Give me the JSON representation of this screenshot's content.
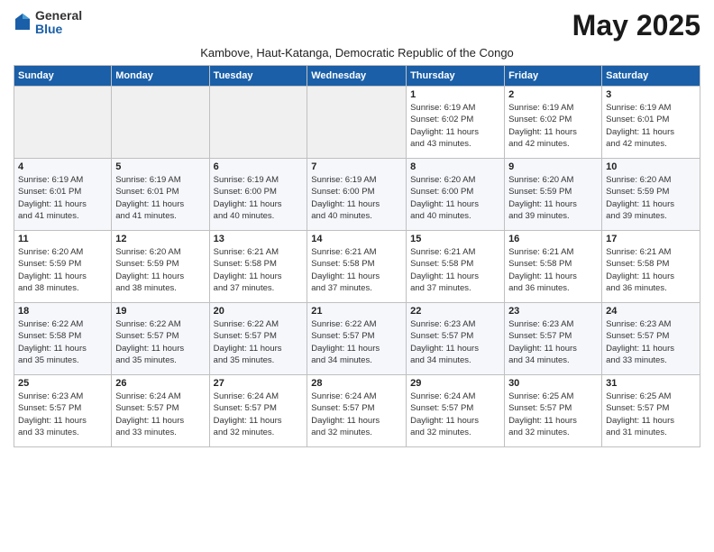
{
  "header": {
    "logo_general": "General",
    "logo_blue": "Blue",
    "month_title": "May 2025",
    "subtitle": "Kambove, Haut-Katanga, Democratic Republic of the Congo"
  },
  "weekdays": [
    "Sunday",
    "Monday",
    "Tuesday",
    "Wednesday",
    "Thursday",
    "Friday",
    "Saturday"
  ],
  "weeks": [
    [
      {
        "day": "",
        "info": ""
      },
      {
        "day": "",
        "info": ""
      },
      {
        "day": "",
        "info": ""
      },
      {
        "day": "",
        "info": ""
      },
      {
        "day": "1",
        "info": "Sunrise: 6:19 AM\nSunset: 6:02 PM\nDaylight: 11 hours\nand 43 minutes."
      },
      {
        "day": "2",
        "info": "Sunrise: 6:19 AM\nSunset: 6:02 PM\nDaylight: 11 hours\nand 42 minutes."
      },
      {
        "day": "3",
        "info": "Sunrise: 6:19 AM\nSunset: 6:01 PM\nDaylight: 11 hours\nand 42 minutes."
      }
    ],
    [
      {
        "day": "4",
        "info": "Sunrise: 6:19 AM\nSunset: 6:01 PM\nDaylight: 11 hours\nand 41 minutes."
      },
      {
        "day": "5",
        "info": "Sunrise: 6:19 AM\nSunset: 6:01 PM\nDaylight: 11 hours\nand 41 minutes."
      },
      {
        "day": "6",
        "info": "Sunrise: 6:19 AM\nSunset: 6:00 PM\nDaylight: 11 hours\nand 40 minutes."
      },
      {
        "day": "7",
        "info": "Sunrise: 6:19 AM\nSunset: 6:00 PM\nDaylight: 11 hours\nand 40 minutes."
      },
      {
        "day": "8",
        "info": "Sunrise: 6:20 AM\nSunset: 6:00 PM\nDaylight: 11 hours\nand 40 minutes."
      },
      {
        "day": "9",
        "info": "Sunrise: 6:20 AM\nSunset: 5:59 PM\nDaylight: 11 hours\nand 39 minutes."
      },
      {
        "day": "10",
        "info": "Sunrise: 6:20 AM\nSunset: 5:59 PM\nDaylight: 11 hours\nand 39 minutes."
      }
    ],
    [
      {
        "day": "11",
        "info": "Sunrise: 6:20 AM\nSunset: 5:59 PM\nDaylight: 11 hours\nand 38 minutes."
      },
      {
        "day": "12",
        "info": "Sunrise: 6:20 AM\nSunset: 5:59 PM\nDaylight: 11 hours\nand 38 minutes."
      },
      {
        "day": "13",
        "info": "Sunrise: 6:21 AM\nSunset: 5:58 PM\nDaylight: 11 hours\nand 37 minutes."
      },
      {
        "day": "14",
        "info": "Sunrise: 6:21 AM\nSunset: 5:58 PM\nDaylight: 11 hours\nand 37 minutes."
      },
      {
        "day": "15",
        "info": "Sunrise: 6:21 AM\nSunset: 5:58 PM\nDaylight: 11 hours\nand 37 minutes."
      },
      {
        "day": "16",
        "info": "Sunrise: 6:21 AM\nSunset: 5:58 PM\nDaylight: 11 hours\nand 36 minutes."
      },
      {
        "day": "17",
        "info": "Sunrise: 6:21 AM\nSunset: 5:58 PM\nDaylight: 11 hours\nand 36 minutes."
      }
    ],
    [
      {
        "day": "18",
        "info": "Sunrise: 6:22 AM\nSunset: 5:58 PM\nDaylight: 11 hours\nand 35 minutes."
      },
      {
        "day": "19",
        "info": "Sunrise: 6:22 AM\nSunset: 5:57 PM\nDaylight: 11 hours\nand 35 minutes."
      },
      {
        "day": "20",
        "info": "Sunrise: 6:22 AM\nSunset: 5:57 PM\nDaylight: 11 hours\nand 35 minutes."
      },
      {
        "day": "21",
        "info": "Sunrise: 6:22 AM\nSunset: 5:57 PM\nDaylight: 11 hours\nand 34 minutes."
      },
      {
        "day": "22",
        "info": "Sunrise: 6:23 AM\nSunset: 5:57 PM\nDaylight: 11 hours\nand 34 minutes."
      },
      {
        "day": "23",
        "info": "Sunrise: 6:23 AM\nSunset: 5:57 PM\nDaylight: 11 hours\nand 34 minutes."
      },
      {
        "day": "24",
        "info": "Sunrise: 6:23 AM\nSunset: 5:57 PM\nDaylight: 11 hours\nand 33 minutes."
      }
    ],
    [
      {
        "day": "25",
        "info": "Sunrise: 6:23 AM\nSunset: 5:57 PM\nDaylight: 11 hours\nand 33 minutes."
      },
      {
        "day": "26",
        "info": "Sunrise: 6:24 AM\nSunset: 5:57 PM\nDaylight: 11 hours\nand 33 minutes."
      },
      {
        "day": "27",
        "info": "Sunrise: 6:24 AM\nSunset: 5:57 PM\nDaylight: 11 hours\nand 32 minutes."
      },
      {
        "day": "28",
        "info": "Sunrise: 6:24 AM\nSunset: 5:57 PM\nDaylight: 11 hours\nand 32 minutes."
      },
      {
        "day": "29",
        "info": "Sunrise: 6:24 AM\nSunset: 5:57 PM\nDaylight: 11 hours\nand 32 minutes."
      },
      {
        "day": "30",
        "info": "Sunrise: 6:25 AM\nSunset: 5:57 PM\nDaylight: 11 hours\nand 32 minutes."
      },
      {
        "day": "31",
        "info": "Sunrise: 6:25 AM\nSunset: 5:57 PM\nDaylight: 11 hours\nand 31 minutes."
      }
    ]
  ]
}
